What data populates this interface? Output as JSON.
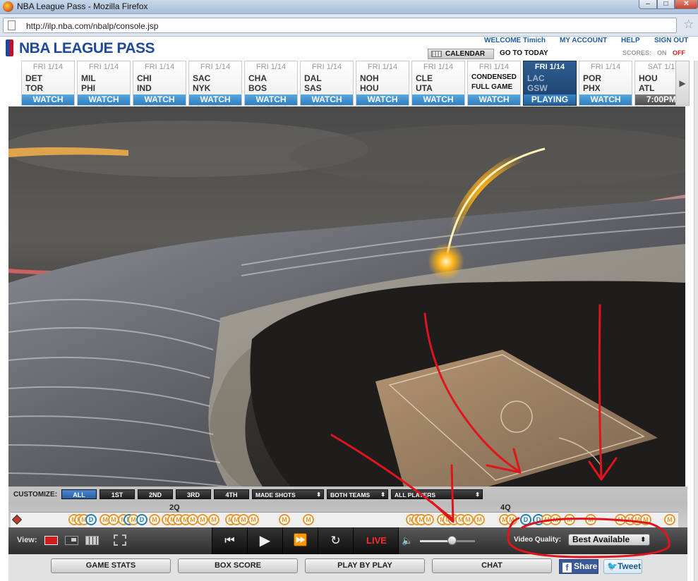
{
  "window": {
    "title": "NBA League Pass - Mozilla Firefox",
    "min": "–",
    "max": "□",
    "close": "✕"
  },
  "browser": {
    "url": "http://ilp.nba.com/nbalp/console.jsp",
    "bookmark_icon": "star-icon"
  },
  "header": {
    "logo": "NBA LEAGUE PASS",
    "welcome": "WELCOME Timich",
    "my_account": "MY ACCOUNT",
    "help": "HELP",
    "sign_out": "SIGN OUT",
    "calendar": "CALENDAR",
    "go_to_today": "GO TO TODAY",
    "scores_label": "SCORES:",
    "scores_on": "ON",
    "scores_off": "OFF"
  },
  "games": [
    {
      "date": "FRI 1/14",
      "away": "DET",
      "home": "TOR",
      "button": "WATCH"
    },
    {
      "date": "FRI 1/14",
      "away": "MIL",
      "home": "PHI",
      "button": "WATCH"
    },
    {
      "date": "FRI 1/14",
      "away": "CHI",
      "home": "IND",
      "button": "WATCH"
    },
    {
      "date": "FRI 1/14",
      "away": "SAC",
      "home": "NYK",
      "button": "WATCH"
    },
    {
      "date": "FRI 1/14",
      "away": "CHA",
      "home": "BOS",
      "button": "WATCH"
    },
    {
      "date": "FRI 1/14",
      "away": "DAL",
      "home": "SAS",
      "button": "WATCH"
    },
    {
      "date": "FRI 1/14",
      "away": "NOH",
      "home": "HOU",
      "button": "WATCH"
    },
    {
      "date": "FRI 1/14",
      "away": "CLE",
      "home": "UTA",
      "button": "WATCH"
    },
    {
      "date": "FRI 1/14",
      "away": "",
      "home": "",
      "overlay_line1": "CONDENSED",
      "overlay_line2": "FULL GAME",
      "button": "WATCH"
    },
    {
      "date": "FRI 1/14",
      "away": "LAC",
      "home": "GSW",
      "button": "PLAYING",
      "active": true
    },
    {
      "date": "FRI 1/14",
      "away": "POR",
      "home": "PHX",
      "button": "WATCH"
    },
    {
      "date": "SAT 1/1",
      "away": "HOU",
      "home": "ATL",
      "button": "7:00PM"
    }
  ],
  "controls": {
    "customize_label": "CUSTOMIZE:",
    "quarters": [
      "ALL",
      "1ST",
      "2ND",
      "3RD",
      "4TH"
    ],
    "filters": [
      "MADE SHOTS",
      "BOTH TEAMS",
      "ALL PLAYERS"
    ],
    "timeline_labels": [
      "2Q",
      "4Q"
    ],
    "marker_letter_made": "M",
    "marker_letter_d": "D",
    "view_label": "View:",
    "live_label": "LIVE",
    "volume_level": 0.58,
    "video_quality_label": "Video Quality:",
    "video_quality_value": "Best Available",
    "tabs": [
      "GAME STATS",
      "BOX SCORE",
      "PLAY BY PLAY",
      "CHAT"
    ],
    "share": "Share",
    "tweet": "Tweet"
  },
  "colors": {
    "nba_blue": "#1d4a9c",
    "watch_blue": "#2d7fc0",
    "live_red": "#ff2b2b",
    "annotation_red": "#e0141c"
  }
}
